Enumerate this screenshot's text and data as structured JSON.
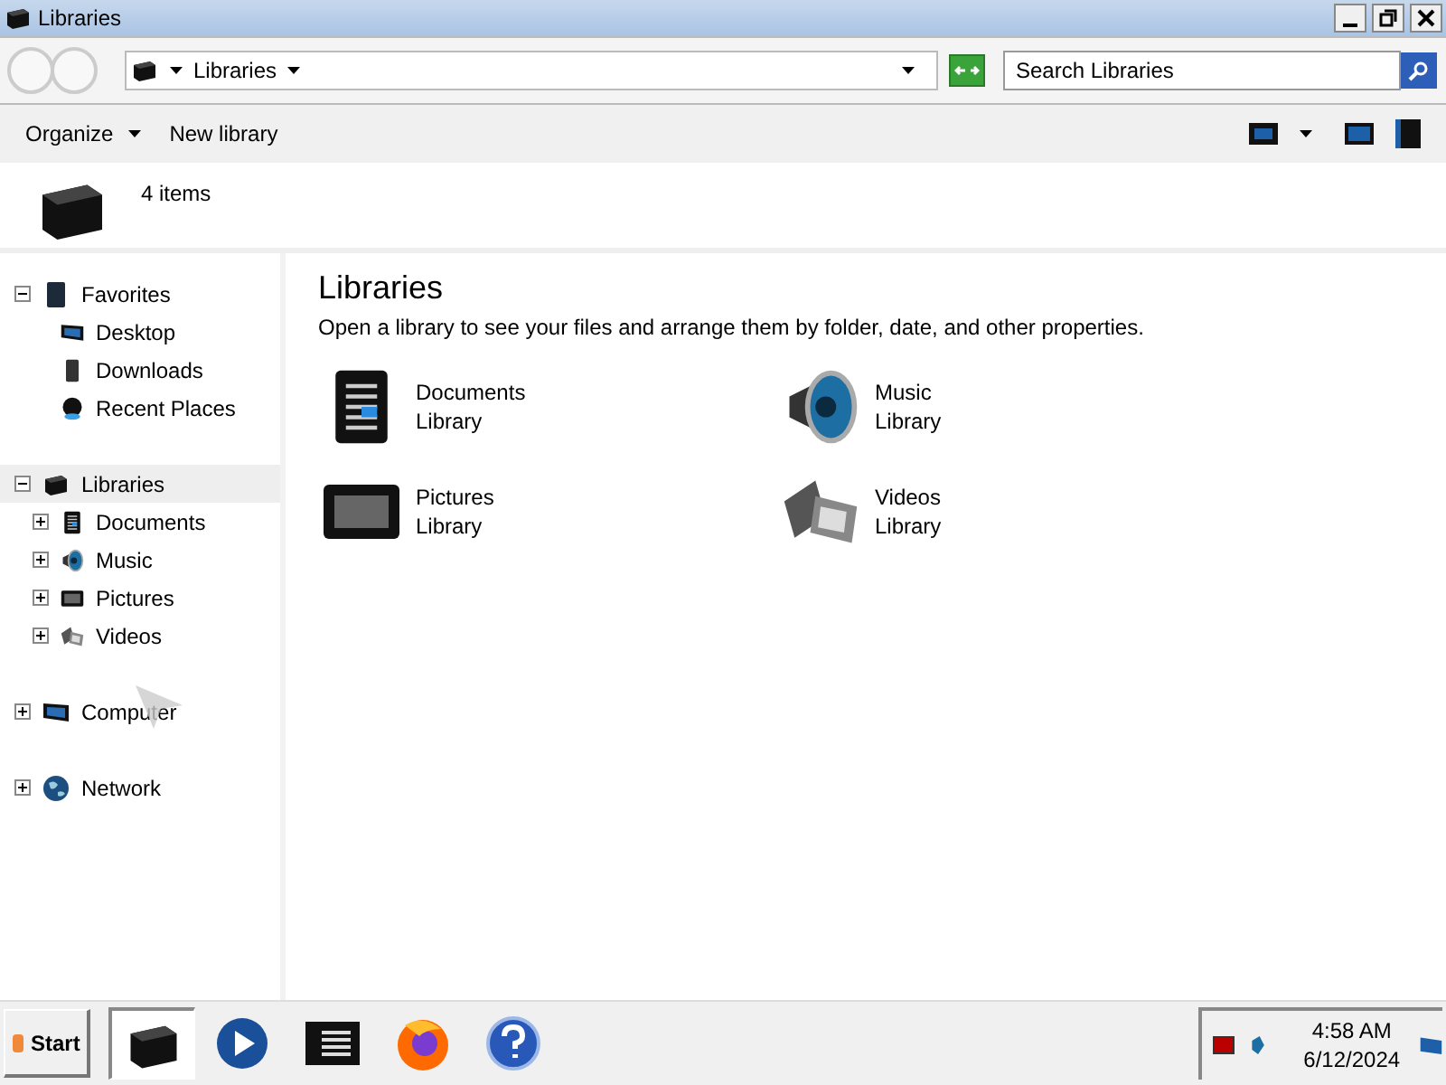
{
  "window": {
    "title": "Libraries"
  },
  "address_bar": {
    "breadcrumb": "Libraries"
  },
  "search": {
    "placeholder": "Search Libraries"
  },
  "toolbar": {
    "buttons": [
      {
        "label": "Organize",
        "dropdown": true
      },
      {
        "label": "New library",
        "dropdown": false
      }
    ]
  },
  "details": {
    "count": "4 items"
  },
  "sidebar": {
    "items": [
      {
        "label": "Favorites",
        "expanded": true,
        "selected": false,
        "children": [
          {
            "label": "Desktop",
            "selected": false
          },
          {
            "label": "Downloads",
            "selected": false
          },
          {
            "label": "Recent Places",
            "selected": false
          }
        ]
      },
      {
        "label": "Libraries",
        "expanded": true,
        "selected": true,
        "children": [
          {
            "label": "Documents",
            "expanded": false,
            "selected": false
          },
          {
            "label": "Music",
            "expanded": false,
            "selected": false
          },
          {
            "label": "Pictures",
            "expanded": false,
            "selected": false
          },
          {
            "label": "Videos",
            "expanded": false,
            "selected": false
          }
        ]
      },
      {
        "label": "Computer",
        "expanded": false,
        "selected": false
      },
      {
        "label": "Network",
        "expanded": false,
        "selected": false
      }
    ]
  },
  "content": {
    "title": "Libraries",
    "description": "Open a library to see your files and arrange them by folder, date, and other properties.",
    "libraries": [
      {
        "name": "Documents",
        "type": "Library",
        "kind": "documents"
      },
      {
        "name": "Music",
        "type": "Library",
        "kind": "music"
      },
      {
        "name": "Pictures",
        "type": "Library",
        "kind": "pictures"
      },
      {
        "name": "Videos",
        "type": "Library",
        "kind": "videos"
      }
    ]
  },
  "taskbar": {
    "start": "Start",
    "apps": [
      {
        "kind": "libraries",
        "selected": true
      },
      {
        "kind": "media",
        "selected": false
      },
      {
        "kind": "notes",
        "selected": false
      },
      {
        "kind": "browser",
        "selected": false
      },
      {
        "kind": "help",
        "selected": false
      }
    ],
    "time": "4:58 AM",
    "date": "6/12/2024"
  }
}
